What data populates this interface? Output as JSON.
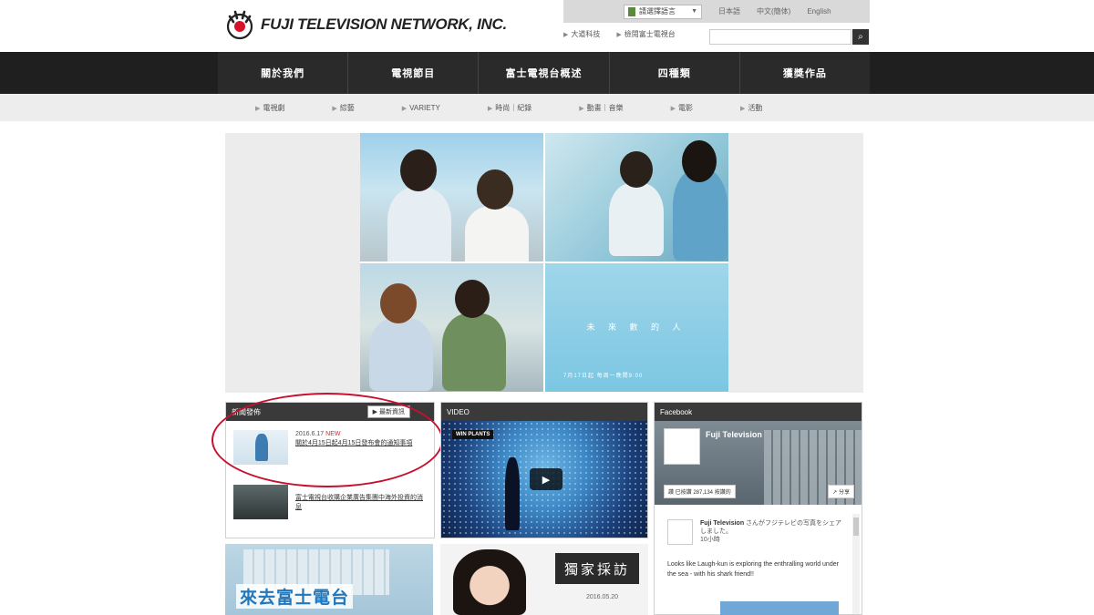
{
  "header": {
    "logo_text": "FUJI TELEVISION NETWORK, INC.",
    "lang_select": "請選擇語言",
    "util_links": [
      "日本語",
      "中文(簡体)",
      "English"
    ],
    "sub_links": [
      "大道科技",
      "檢閱富士電視台"
    ],
    "search_placeholder": ""
  },
  "main_nav": [
    "關於我們",
    "電視節目",
    "富士電視台概述",
    "四種類",
    "獲獎作品"
  ],
  "sub_nav": [
    "電視劇",
    "綜藝",
    "VARIETY",
    "時尚｜紀錄",
    "動畫｜音樂",
    "電影",
    "活動"
  ],
  "hero": {
    "title": "未 來 數 的 人",
    "date_line": "7月17日起 每周一晚間9:00"
  },
  "news": {
    "header": "新聞發佈",
    "more_label": "▶ 最新資訊",
    "items": [
      {
        "date": "2016.6.17",
        "badge": "NEW",
        "title": "關於4月15日起4月15日發布會的通知事項"
      },
      {
        "date": "",
        "badge": "",
        "title": "富士電視台收購企業廣告集團中海外投資的消息"
      }
    ]
  },
  "video": {
    "header": "VIDEO",
    "tag": "WIN PLANTS",
    "play_label": "▶"
  },
  "facebook": {
    "header": "Facebook",
    "page_name": "Fuji Television",
    "like_label": "讚 已按讚 287,134 按讚的",
    "share_label": "↗ 分享",
    "post_author": "Fuji Television",
    "post_meta": "さんがフジテレビの写真をシェアしました。",
    "post_time": "10小時",
    "post_text": "Looks like Laugh-kun is exploring the enthralling world under the sea - with his shark friend!!"
  },
  "promo": {
    "text": "來去富士電台"
  },
  "interview": {
    "badge": "獨家採訪",
    "date": "2016.05.20"
  },
  "colors": {
    "nav_bg": "#2a2a2a",
    "accent_red": "#c8102e",
    "link_blue": "#2277bb"
  }
}
